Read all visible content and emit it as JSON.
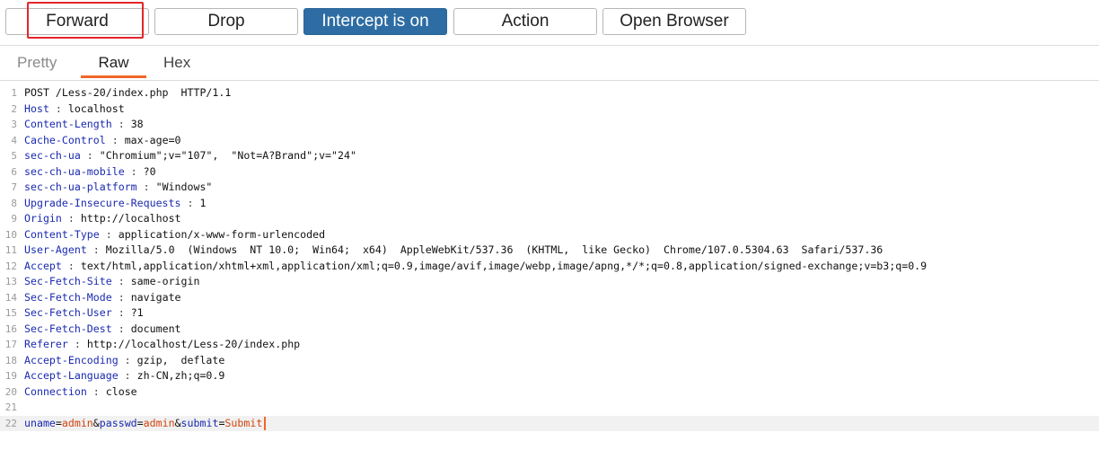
{
  "toolbar": {
    "forward": "Forward",
    "drop": "Drop",
    "intercept": "Intercept is on",
    "action": "Action",
    "open_browser": "Open Browser"
  },
  "tabs": {
    "pretty": "Pretty",
    "raw": "Raw",
    "hex": "Hex",
    "active": "Raw"
  },
  "colors": {
    "intercept_bg": "#2e6da4",
    "highlight_box": "#e4262b",
    "tab_underline": "#f0662a",
    "header_name": "#1a2ab0",
    "param_value": "#d2440f"
  },
  "request": {
    "request_line": "POST /Less-20/index.php  HTTP/1.1",
    "headers": [
      {
        "name": "Host",
        "value": "localhost"
      },
      {
        "name": "Content-Length",
        "value": "38"
      },
      {
        "name": "Cache-Control",
        "value": "max-age=0"
      },
      {
        "name": "sec-ch-ua",
        "value": "\"Chromium\";v=\"107\",  \"Not=A?Brand\";v=\"24\""
      },
      {
        "name": "sec-ch-ua-mobile",
        "value": "?0"
      },
      {
        "name": "sec-ch-ua-platform",
        "value": "\"Windows\""
      },
      {
        "name": "Upgrade-Insecure-Requests",
        "value": "1"
      },
      {
        "name": "Origin",
        "value": "http://localhost"
      },
      {
        "name": "Content-Type",
        "value": "application/x-www-form-urlencoded"
      },
      {
        "name": "User-Agent",
        "value": "Mozilla/5.0  (Windows  NT 10.0;  Win64;  x64)  AppleWebKit/537.36  (KHTML,  like Gecko)  Chrome/107.0.5304.63  Safari/537.36"
      },
      {
        "name": "Accept",
        "value": "text/html,application/xhtml+xml,application/xml;q=0.9,image/avif,image/webp,image/apng,*/*;q=0.8,application/signed-exchange;v=b3;q=0.9"
      },
      {
        "name": "Sec-Fetch-Site",
        "value": "same-origin"
      },
      {
        "name": "Sec-Fetch-Mode",
        "value": "navigate"
      },
      {
        "name": "Sec-Fetch-User",
        "value": "?1"
      },
      {
        "name": "Sec-Fetch-Dest",
        "value": "document"
      },
      {
        "name": "Referer",
        "value": "http://localhost/Less-20/index.php"
      },
      {
        "name": "Accept-Encoding",
        "value": "gzip,  deflate"
      },
      {
        "name": "Accept-Language",
        "value": "zh-CN,zh;q=0.9"
      },
      {
        "name": "Connection",
        "value": "close"
      }
    ],
    "body_params": [
      {
        "key": "uname",
        "value": "admin"
      },
      {
        "key": "passwd",
        "value": "admin"
      },
      {
        "key": "submit",
        "value": "Submit"
      }
    ]
  }
}
